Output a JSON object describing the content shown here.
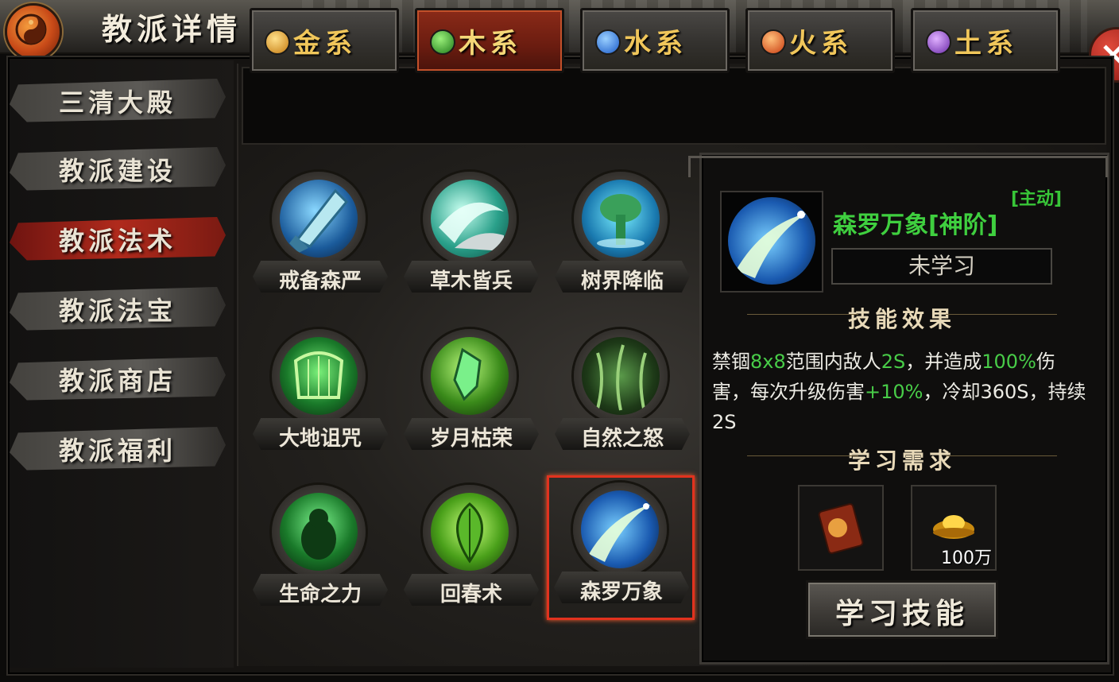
{
  "header": {
    "title": "教派详情"
  },
  "nav": {
    "items": [
      {
        "label": "三清大殿"
      },
      {
        "label": "教派建设"
      },
      {
        "label": "教派法术"
      },
      {
        "label": "教派法宝"
      },
      {
        "label": "教派商店"
      },
      {
        "label": "教派福利"
      }
    ],
    "active": "教派法术"
  },
  "tabs": {
    "items": [
      {
        "label": "金系",
        "color": "#f0b43a"
      },
      {
        "label": "木系",
        "color": "#4fcf42"
      },
      {
        "label": "水系",
        "color": "#3c8ef0"
      },
      {
        "label": "火系",
        "color": "#f06a2a"
      },
      {
        "label": "土系",
        "color": "#9a5ad8"
      }
    ],
    "active": "木系"
  },
  "skills": [
    {
      "label": "戒备森严",
      "icon": "crystal-sword-icon"
    },
    {
      "label": "草木皆兵",
      "icon": "wave-blade-icon"
    },
    {
      "label": "树界降临",
      "icon": "tree-spirit-icon"
    },
    {
      "label": "大地诅咒",
      "icon": "harp-icon"
    },
    {
      "label": "岁月枯荣",
      "icon": "green-crystal-icon"
    },
    {
      "label": "自然之怒",
      "icon": "vines-icon"
    },
    {
      "label": "生命之力",
      "icon": "green-beast-icon"
    },
    {
      "label": "回春术",
      "icon": "leaf-icon"
    },
    {
      "label": "森罗万象",
      "icon": "comet-icon"
    }
  ],
  "selected_skill": "森罗万象",
  "detail": {
    "type_tag": "[主动]",
    "name": "森罗万象[神阶]",
    "status": "未学习",
    "effect_title": "技能效果",
    "effect": {
      "p1": "禁锢",
      "g1": "8x8",
      "p2": "范围内敌人",
      "g2": "2S",
      "p3": "，并造成",
      "g3": "100%",
      "p4": "伤害，每次升级伤害",
      "g4": "+10%",
      "p5": "，冷却360S，持续2S"
    },
    "req_title": "学习需求",
    "requirements": [
      {
        "icon": "skill-book-icon",
        "qty": ""
      },
      {
        "icon": "gold-ingot-icon",
        "qty": "100万"
      }
    ],
    "learn_button": "学习技能"
  }
}
